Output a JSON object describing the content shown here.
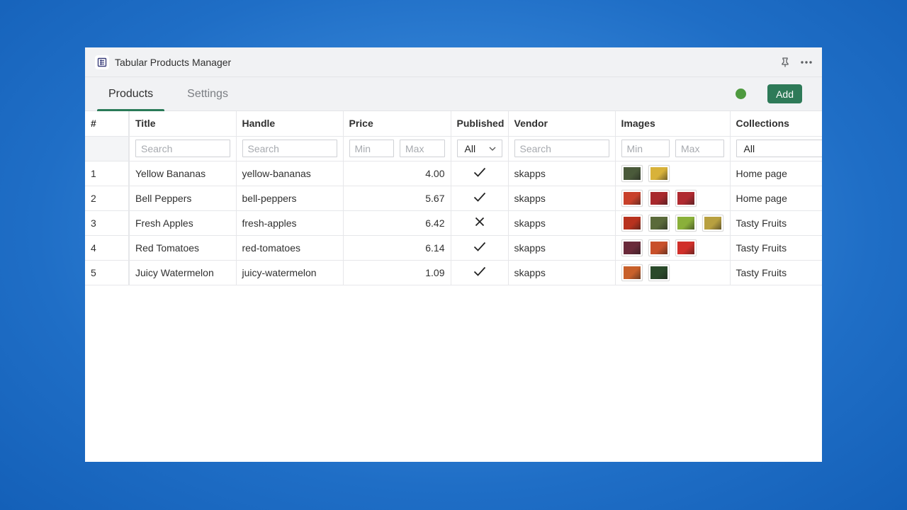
{
  "window": {
    "title": "Tabular Products Manager",
    "icons": {
      "app": "table-list-icon",
      "pin": "pin-icon",
      "more": "more-horizontal-icon"
    }
  },
  "tabs": [
    {
      "label": "Products",
      "active": true
    },
    {
      "label": "Settings",
      "active": false
    }
  ],
  "toolbar": {
    "status_color": "#4e9a3f",
    "add_label": "Add",
    "accent": "#2e7a58"
  },
  "table": {
    "columns": [
      "#",
      "Title",
      "Handle",
      "Price",
      "Published",
      "Vendor",
      "Images",
      "Collections"
    ],
    "filters": {
      "title_placeholder": "Search",
      "handle_placeholder": "Search",
      "price_min_placeholder": "Min",
      "price_max_placeholder": "Max",
      "published_value": "All",
      "vendor_placeholder": "Search",
      "images_min_placeholder": "Min",
      "images_max_placeholder": "Max",
      "collections_value": "All"
    },
    "rows": [
      {
        "num": "1",
        "title": "Yellow Bananas",
        "handle": "yellow-bananas",
        "price": "4.00",
        "published": true,
        "vendor": "skapps",
        "images": [
          "#4a5a3a",
          "#d8b23a"
        ],
        "collection": "Home page"
      },
      {
        "num": "2",
        "title": "Bell Peppers",
        "handle": "bell-peppers",
        "price": "5.67",
        "published": true,
        "vendor": "skapps",
        "images": [
          "#c8402a",
          "#a8282c",
          "#b02a30"
        ],
        "collection": "Home page"
      },
      {
        "num": "3",
        "title": "Fresh Apples",
        "handle": "fresh-apples",
        "price": "6.42",
        "published": false,
        "vendor": "skapps",
        "images": [
          "#b8321e",
          "#5a6a3a",
          "#8ab03a",
          "#b8a040"
        ],
        "collection": "Tasty Fruits"
      },
      {
        "num": "4",
        "title": "Red Tomatoes",
        "handle": "red-tomatoes",
        "price": "6.14",
        "published": true,
        "vendor": "skapps",
        "images": [
          "#6a2a3a",
          "#c8502a",
          "#d0302a"
        ],
        "collection": "Tasty Fruits"
      },
      {
        "num": "5",
        "title": "Juicy Watermelon",
        "handle": "juicy-watermelon",
        "price": "1.09",
        "published": true,
        "vendor": "skapps",
        "images": [
          "#c8602a",
          "#2a4a2a"
        ],
        "collection": "Tasty Fruits"
      }
    ]
  }
}
